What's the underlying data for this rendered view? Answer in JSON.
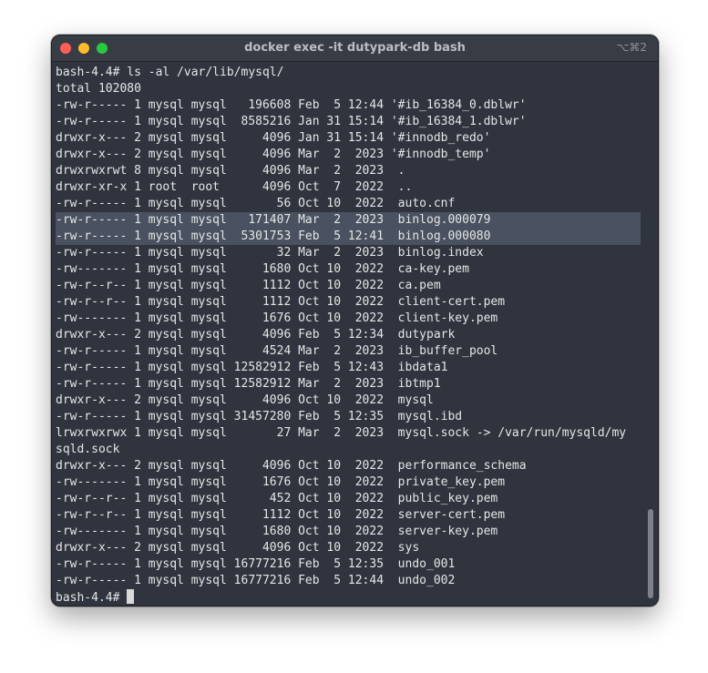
{
  "window": {
    "title": "docker exec -it dutypark-db bash",
    "shortcut": "⌥⌘2"
  },
  "terminal": {
    "command_line": "bash-4.4# ls -al /var/lib/mysql/",
    "total_line": "total 102080",
    "lines": [
      {
        "text": "-rw-r----- 1 mysql mysql   196608 Feb  5 12:44 '#ib_16384_0.dblwr'",
        "highlighted": false
      },
      {
        "text": "-rw-r----- 1 mysql mysql  8585216 Jan 31 15:14 '#ib_16384_1.dblwr'",
        "highlighted": false
      },
      {
        "text": "drwxr-x--- 2 mysql mysql     4096 Jan 31 15:14 '#innodb_redo'",
        "highlighted": false
      },
      {
        "text": "drwxr-x--- 2 mysql mysql     4096 Mar  2  2023 '#innodb_temp'",
        "highlighted": false
      },
      {
        "text": "drwxrwxrwt 8 mysql mysql     4096 Mar  2  2023  .",
        "highlighted": false
      },
      {
        "text": "drwxr-xr-x 1 root  root      4096 Oct  7  2022  ..",
        "highlighted": false
      },
      {
        "text": "-rw-r----- 1 mysql mysql       56 Oct 10  2022  auto.cnf",
        "highlighted": false
      },
      {
        "text": "-rw-r----- 1 mysql mysql   171407 Mar  2  2023  binlog.000079",
        "highlighted": true
      },
      {
        "text": "-rw-r----- 1 mysql mysql  5301753 Feb  5 12:41  binlog.000080",
        "highlighted": true
      },
      {
        "text": "-rw-r----- 1 mysql mysql       32 Mar  2  2023  binlog.index",
        "highlighted": false
      },
      {
        "text": "-rw------- 1 mysql mysql     1680 Oct 10  2022  ca-key.pem",
        "highlighted": false
      },
      {
        "text": "-rw-r--r-- 1 mysql mysql     1112 Oct 10  2022  ca.pem",
        "highlighted": false
      },
      {
        "text": "-rw-r--r-- 1 mysql mysql     1112 Oct 10  2022  client-cert.pem",
        "highlighted": false
      },
      {
        "text": "-rw------- 1 mysql mysql     1676 Oct 10  2022  client-key.pem",
        "highlighted": false
      },
      {
        "text": "drwxr-x--- 2 mysql mysql     4096 Feb  5 12:34  dutypark",
        "highlighted": false
      },
      {
        "text": "-rw-r----- 1 mysql mysql     4524 Mar  2  2023  ib_buffer_pool",
        "highlighted": false
      },
      {
        "text": "-rw-r----- 1 mysql mysql 12582912 Feb  5 12:43  ibdata1",
        "highlighted": false
      },
      {
        "text": "-rw-r----- 1 mysql mysql 12582912 Mar  2  2023  ibtmp1",
        "highlighted": false
      },
      {
        "text": "drwxr-x--- 2 mysql mysql     4096 Oct 10  2022  mysql",
        "highlighted": false
      },
      {
        "text": "-rw-r----- 1 mysql mysql 31457280 Feb  5 12:35  mysql.ibd",
        "highlighted": false
      },
      {
        "text": "lrwxrwxrwx 1 mysql mysql       27 Mar  2  2023  mysql.sock -> /var/run/mysqld/my",
        "highlighted": false
      },
      {
        "text": "sqld.sock",
        "highlighted": false
      },
      {
        "text": "drwxr-x--- 2 mysql mysql     4096 Oct 10  2022  performance_schema",
        "highlighted": false
      },
      {
        "text": "-rw------- 1 mysql mysql     1676 Oct 10  2022  private_key.pem",
        "highlighted": false
      },
      {
        "text": "-rw-r--r-- 1 mysql mysql      452 Oct 10  2022  public_key.pem",
        "highlighted": false
      },
      {
        "text": "-rw-r--r-- 1 mysql mysql     1112 Oct 10  2022  server-cert.pem",
        "highlighted": false
      },
      {
        "text": "-rw------- 1 mysql mysql     1680 Oct 10  2022  server-key.pem",
        "highlighted": false
      },
      {
        "text": "drwxr-x--- 2 mysql mysql     4096 Oct 10  2022  sys",
        "highlighted": false
      },
      {
        "text": "-rw-r----- 1 mysql mysql 16777216 Feb  5 12:35  undo_001",
        "highlighted": false
      },
      {
        "text": "-rw-r----- 1 mysql mysql 16777216 Feb  5 12:44  undo_002",
        "highlighted": false
      }
    ],
    "prompt": "bash-4.4# "
  },
  "colors": {
    "background": "#2f343e",
    "titlebar": "#383c45",
    "text": "#e6e6e6",
    "highlight": "#4a5160",
    "close": "#ff5f57",
    "minimize": "#febc2e",
    "zoom": "#28c840"
  }
}
